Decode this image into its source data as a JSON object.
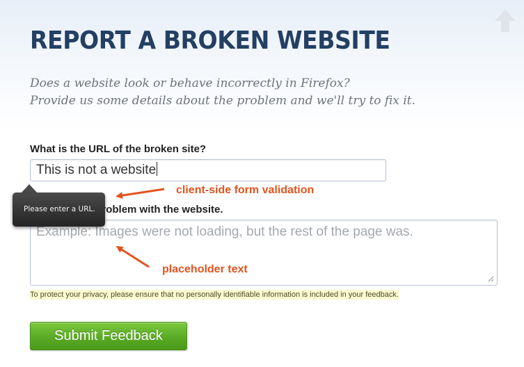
{
  "header": {
    "title": "REPORT A BROKEN WEBSITE",
    "subtitle_line1": "Does a website look or behave incorrectly in Firefox?",
    "subtitle_line2": "Provide us some details about the problem and we'll try to fix it."
  },
  "form": {
    "url_label": "What is the URL of the broken site?",
    "url_value": "This is not a website",
    "description_label": "Describe the problem with the website.",
    "description_placeholder": "Example: Images were not loading, but the rest of the page was.",
    "validation_message": "Please enter a URL.",
    "privacy_note": "To protect your privacy, please ensure that no personally identifiable information is included in your feedback.",
    "submit_label": "Submit Feedback"
  },
  "annotations": {
    "validation": "client-side form validation",
    "placeholder": "placeholder text"
  },
  "icons": {
    "scroll_top": "up-arrow-icon",
    "resize": "resize-grip-icon"
  },
  "colors": {
    "title": "#233f63",
    "annotation": "#e2541d",
    "submit_button": "#5aaa25",
    "privacy_highlight": "#fbfbcf"
  }
}
